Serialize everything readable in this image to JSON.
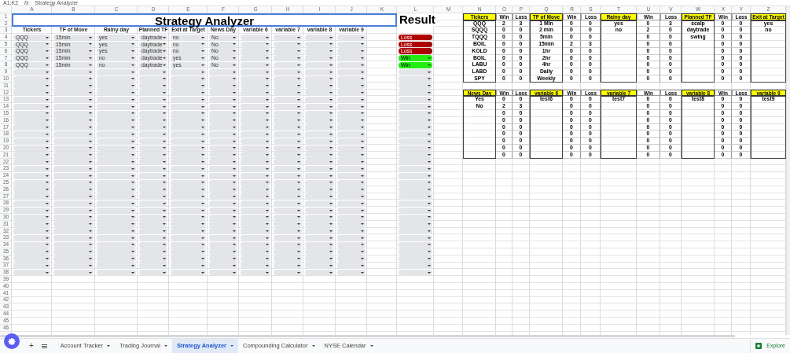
{
  "formula_bar": {
    "cell_ref": "A1:K2",
    "fx": "fx",
    "content": "Strategy Analyzer"
  },
  "sheet": {
    "column_letters": [
      "A",
      "B",
      "C",
      "D",
      "E",
      "F",
      "G",
      "H",
      "I",
      "J",
      "K",
      "L",
      "M",
      "N",
      "O",
      "P",
      "Q",
      "R",
      "S",
      "T",
      "U",
      "V",
      "W",
      "X",
      "Y",
      "Z"
    ],
    "row_numbers": [
      "1",
      "2",
      "3",
      "4",
      "5",
      "6",
      "7",
      "8",
      "9",
      "10",
      "11",
      "12",
      "13",
      "14",
      "15",
      "16",
      "17",
      "18",
      "19",
      "20",
      "21",
      "22",
      "23",
      "24",
      "25",
      "26",
      "27",
      "28",
      "29",
      "30",
      "31",
      "32",
      "33",
      "34",
      "35",
      "36",
      "37",
      "38",
      "39",
      "40",
      "41",
      "42",
      "43",
      "44",
      "45",
      "46"
    ]
  },
  "journal": {
    "title": "Strategy Analyzer",
    "result_title": "Result",
    "headers": [
      "Tickers",
      "TF of Move",
      "Rainy day",
      "Planned TF",
      "Exit at Target",
      "News Day",
      "variable 6",
      "variable 7",
      "variable 8",
      "variable 9"
    ],
    "rows": [
      {
        "kind": "entry",
        "values": [
          "QQQ",
          "15min",
          "yes",
          "daytrade",
          "no",
          "No"
        ],
        "result": {
          "text": "Loss",
          "color": "#b00000"
        }
      },
      {
        "kind": "entry",
        "values": [
          "QQQ",
          "15min",
          "yes",
          "daytrade",
          "no",
          "No"
        ],
        "result": {
          "text": "Loss",
          "color": "#b00000"
        }
      },
      {
        "kind": "entry",
        "values": [
          "QQQ",
          "15min",
          "yes",
          "daytrade",
          "no",
          "No"
        ],
        "result": {
          "text": "Loss",
          "color": "#b00000"
        }
      },
      {
        "kind": "entry",
        "values": [
          "QQQ",
          "15min",
          "no",
          "daytrade",
          "yes",
          "No"
        ],
        "result": {
          "text": "Win",
          "color": "#22ee11"
        }
      },
      {
        "kind": "entry",
        "values": [
          "QQQ",
          "15min",
          "no",
          "daytrade",
          "yes",
          "No"
        ],
        "result": {
          "text": "Win",
          "color": "#22ee11"
        }
      },
      {
        "kind": "blank"
      },
      {
        "kind": "blank"
      },
      {
        "kind": "blank"
      },
      {
        "kind": "blank"
      },
      {
        "kind": "blank"
      },
      {
        "kind": "blank"
      },
      {
        "kind": "blank"
      },
      {
        "kind": "blank"
      },
      {
        "kind": "blank"
      },
      {
        "kind": "blank"
      },
      {
        "kind": "blank"
      },
      {
        "kind": "blank"
      },
      {
        "kind": "blank"
      },
      {
        "kind": "blank"
      },
      {
        "kind": "blank"
      },
      {
        "kind": "blank"
      },
      {
        "kind": "blank"
      },
      {
        "kind": "blank"
      },
      {
        "kind": "blank"
      },
      {
        "kind": "blank"
      },
      {
        "kind": "blank"
      },
      {
        "kind": "blank"
      },
      {
        "kind": "blank"
      },
      {
        "kind": "blank"
      },
      {
        "kind": "blank"
      },
      {
        "kind": "blank"
      },
      {
        "kind": "blank"
      },
      {
        "kind": "blank"
      },
      {
        "kind": "blank"
      },
      {
        "kind": "blank"
      }
    ]
  },
  "summary": {
    "tables": [
      {
        "groups": [
          {
            "kind": "stats",
            "header": "Tickers",
            "win_header": "Win",
            "loss_header": "Loss",
            "rows": [
              {
                "label": "QQQ",
                "win": "2",
                "loss": "3"
              },
              {
                "label": "SQQQ",
                "win": "0",
                "loss": "0"
              },
              {
                "label": "TQQQ",
                "win": "0",
                "loss": "0"
              },
              {
                "label": "BOIL",
                "win": "0",
                "loss": "0"
              },
              {
                "label": "KOLD",
                "win": "0",
                "loss": "0"
              },
              {
                "label": "BOIL",
                "win": "0",
                "loss": "0"
              },
              {
                "label": "LABU",
                "win": "0",
                "loss": "0"
              },
              {
                "label": "LABD",
                "win": "0",
                "loss": "0"
              },
              {
                "label": "SPY",
                "win": "0",
                "loss": "0"
              }
            ]
          },
          {
            "kind": "stats",
            "header": "TF of Move",
            "win_header": "Win",
            "loss_header": "Loss",
            "rows": [
              {
                "label": "1 Min",
                "win": "0",
                "loss": "0"
              },
              {
                "label": "2 min",
                "win": "0",
                "loss": "0"
              },
              {
                "label": "5min",
                "win": "0",
                "loss": "0"
              },
              {
                "label": "15min",
                "win": "2",
                "loss": "3"
              },
              {
                "label": "1hr",
                "win": "0",
                "loss": "0"
              },
              {
                "label": "2hr",
                "win": "0",
                "loss": "0"
              },
              {
                "label": "4hr",
                "win": "0",
                "loss": "0"
              },
              {
                "label": "Daily",
                "win": "0",
                "loss": "0"
              },
              {
                "label": "Weekly",
                "win": "0",
                "loss": "0"
              }
            ]
          },
          {
            "kind": "stats",
            "header": "Rainy day",
            "win_header": "Win",
            "loss_header": "Loss",
            "rows": [
              {
                "label": "yes",
                "win": "0",
                "loss": "3"
              },
              {
                "label": "no",
                "win": "2",
                "loss": "0"
              },
              {
                "win": "0",
                "loss": "0"
              },
              {
                "win": "0",
                "loss": "0"
              },
              {
                "win": "0",
                "loss": "0"
              },
              {
                "win": "0",
                "loss": "0"
              },
              {
                "win": "0",
                "loss": "0"
              },
              {
                "win": "0",
                "loss": "0"
              },
              {
                "win": "0",
                "loss": "0"
              }
            ]
          },
          {
            "kind": "stats",
            "header": "Planned TF",
            "win_header": "Win",
            "loss_header": "Loss",
            "rows": [
              {
                "label": "scalp",
                "win": "0",
                "loss": "0"
              },
              {
                "label": "daytrade",
                "win": "0",
                "loss": "0"
              },
              {
                "label": "swing",
                "win": "0",
                "loss": "0"
              },
              {
                "win": "0",
                "loss": "0"
              },
              {
                "win": "0",
                "loss": "0"
              },
              {
                "win": "0",
                "loss": "0"
              },
              {
                "win": "0",
                "loss": "0"
              },
              {
                "win": "0",
                "loss": "0"
              },
              {
                "win": "0",
                "loss": "0"
              }
            ]
          },
          {
            "kind": "labels_only",
            "header": "Exit at Target",
            "labels": [
              "yes",
              "no"
            ]
          }
        ]
      },
      {
        "groups": [
          {
            "kind": "stats",
            "header": "News Day",
            "win_header": "Win",
            "loss_header": "Loss",
            "rows": [
              {
                "label": "Yes",
                "win": "0",
                "loss": "0"
              },
              {
                "label": "No",
                "win": "2",
                "loss": "3"
              },
              {
                "win": "0",
                "loss": "0"
              },
              {
                "win": "0",
                "loss": "0"
              },
              {
                "win": "0",
                "loss": "0"
              },
              {
                "win": "0",
                "loss": "0"
              },
              {
                "win": "0",
                "loss": "0"
              },
              {
                "win": "0",
                "loss": "0"
              },
              {
                "win": "0",
                "loss": "0"
              }
            ]
          },
          {
            "kind": "stats",
            "header": "variable 6",
            "win_header": "Win",
            "loss_header": "Loss",
            "rows": [
              {
                "label": "test6",
                "win": "0",
                "loss": "0"
              },
              {
                "win": "0",
                "loss": "0"
              },
              {
                "win": "0",
                "loss": "0"
              },
              {
                "win": "0",
                "loss": "0"
              },
              {
                "win": "0",
                "loss": "0"
              },
              {
                "win": "0",
                "loss": "0"
              },
              {
                "win": "0",
                "loss": "0"
              },
              {
                "win": "0",
                "loss": "0"
              },
              {
                "win": "0",
                "loss": "0"
              }
            ]
          },
          {
            "kind": "stats",
            "header": "variable 7",
            "win_header": "Win",
            "loss_header": "Loss",
            "rows": [
              {
                "label": "test7",
                "win": "0",
                "loss": "0"
              },
              {
                "win": "0",
                "loss": "0"
              },
              {
                "win": "0",
                "loss": "0"
              },
              {
                "win": "0",
                "loss": "0"
              },
              {
                "win": "0",
                "loss": "0"
              },
              {
                "win": "0",
                "loss": "0"
              },
              {
                "win": "0",
                "loss": "0"
              },
              {
                "win": "0",
                "loss": "0"
              },
              {
                "win": "0",
                "loss": "0"
              }
            ]
          },
          {
            "kind": "stats",
            "header": "variable 8",
            "win_header": "Win",
            "loss_header": "Loss",
            "rows": [
              {
                "label": "test8",
                "win": "0",
                "loss": "0"
              },
              {
                "win": "0",
                "loss": "0"
              },
              {
                "win": "0",
                "loss": "0"
              },
              {
                "win": "0",
                "loss": "0"
              },
              {
                "win": "0",
                "loss": "0"
              },
              {
                "win": "0",
                "loss": "0"
              },
              {
                "win": "0",
                "loss": "0"
              },
              {
                "win": "0",
                "loss": "0"
              },
              {
                "win": "0",
                "loss": "0"
              }
            ]
          },
          {
            "kind": "labels_only",
            "header": "variable 9",
            "labels": [
              "test9"
            ]
          }
        ]
      }
    ]
  },
  "tab_bar": {
    "add_label": "+",
    "tabs": [
      {
        "label": "Account Tracker",
        "selected": false
      },
      {
        "label": "Trading Journal",
        "selected": false
      },
      {
        "label": "Strategy Analyzer",
        "selected": true
      },
      {
        "label": "Compounding Calculator",
        "selected": false
      },
      {
        "label": "NYSE Calendar",
        "selected": false
      }
    ],
    "explore_label": "Explore"
  }
}
